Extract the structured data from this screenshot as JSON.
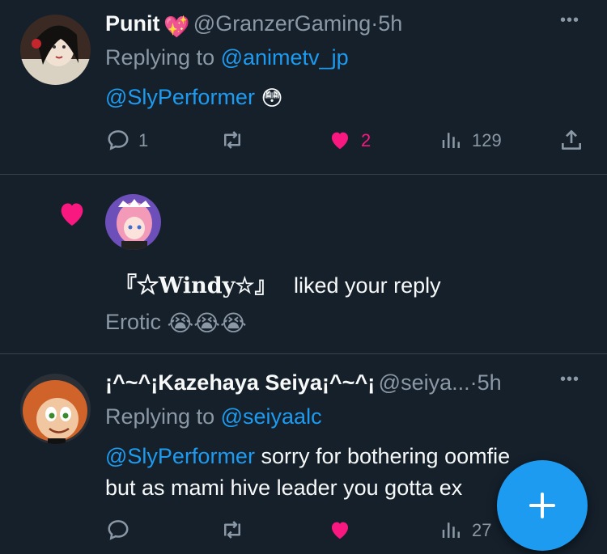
{
  "tweet1": {
    "name": "Punit",
    "name_emoji": "💖",
    "handle": "@GranzerGaming",
    "separator": "·",
    "time": "5h",
    "more": "•••",
    "replying_prefix": "Replying to",
    "replying_handle": "@animetv_jp",
    "mention": "@SlyPerformer",
    "content_emoji": "😳",
    "reply_count": "1",
    "retweet_count": "",
    "like_count": "2",
    "view_count": "129",
    "liked": true
  },
  "notification": {
    "user": "『☆Windy☆』",
    "action": "liked your reply",
    "preview_text": "Erotic",
    "preview_emojis": [
      "😭",
      "😭",
      "😭"
    ]
  },
  "tweet2": {
    "name": "¡^~^¡Kazehaya Seiya¡^~^¡",
    "handle": "@seiya...",
    "separator": "·",
    "time": "5h",
    "more": "•••",
    "replying_prefix": "Replying to",
    "replying_handle": "@seiyaalc",
    "mention": "@SlyPerformer",
    "text_line1": "sorry for bothering oomfie",
    "text_line2": "but as mami hive leader you gotta ex",
    "view_count": "27"
  },
  "fab": {
    "label": "+"
  },
  "colors": {
    "background": "#15202b",
    "link": "#1d9bf0",
    "like": "#f91880",
    "muted": "#8b98a5",
    "divider": "#38444d"
  },
  "icons": {
    "reply": "reply-icon",
    "retweet": "retweet-icon",
    "like": "heart-icon",
    "views": "analytics-icon",
    "share": "share-icon",
    "compose": "plus-icon"
  }
}
